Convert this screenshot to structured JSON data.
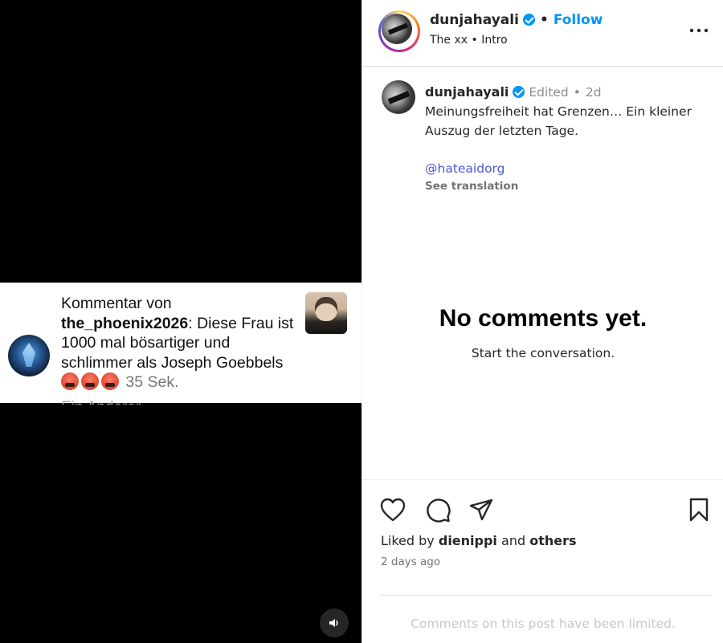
{
  "comment_overlay": {
    "prefix": "Kommentar von",
    "username": "the_phoenix2026",
    "text": ": Diese Frau ist 1000 mal bösartiger und schlimmer als Joseph Goebbels",
    "emojis": [
      "angry-face-emoji",
      "angry-face-emoji",
      "angry-face-emoji"
    ],
    "time": "35 Sek.",
    "faded_text": "Ein Anderer"
  },
  "header": {
    "username": "dunjahayali",
    "follow_label": "Follow",
    "separator": "•",
    "subtitle": "The xx • Intro"
  },
  "caption": {
    "username": "dunjahayali",
    "edited": "Edited",
    "separator": "•",
    "age": "2d",
    "text": "Meinungsfreiheit hat Grenzen… Ein kleiner Auszug der letzten Tage.",
    "mention": "@hateaidorg",
    "translate_label": "See translation"
  },
  "empty_state": {
    "title": "No comments yet.",
    "subtitle": "Start the conversation."
  },
  "engagement": {
    "liked_by_prefix": "Liked by",
    "liked_by_user": "dienippi",
    "and": "and",
    "others": "others",
    "timestamp": "2 days ago",
    "limited_notice": "Comments on this post have been limited."
  },
  "colors": {
    "accent": "#0095f6",
    "mention": "#4b5bd8",
    "muted": "#8e8e8e"
  }
}
